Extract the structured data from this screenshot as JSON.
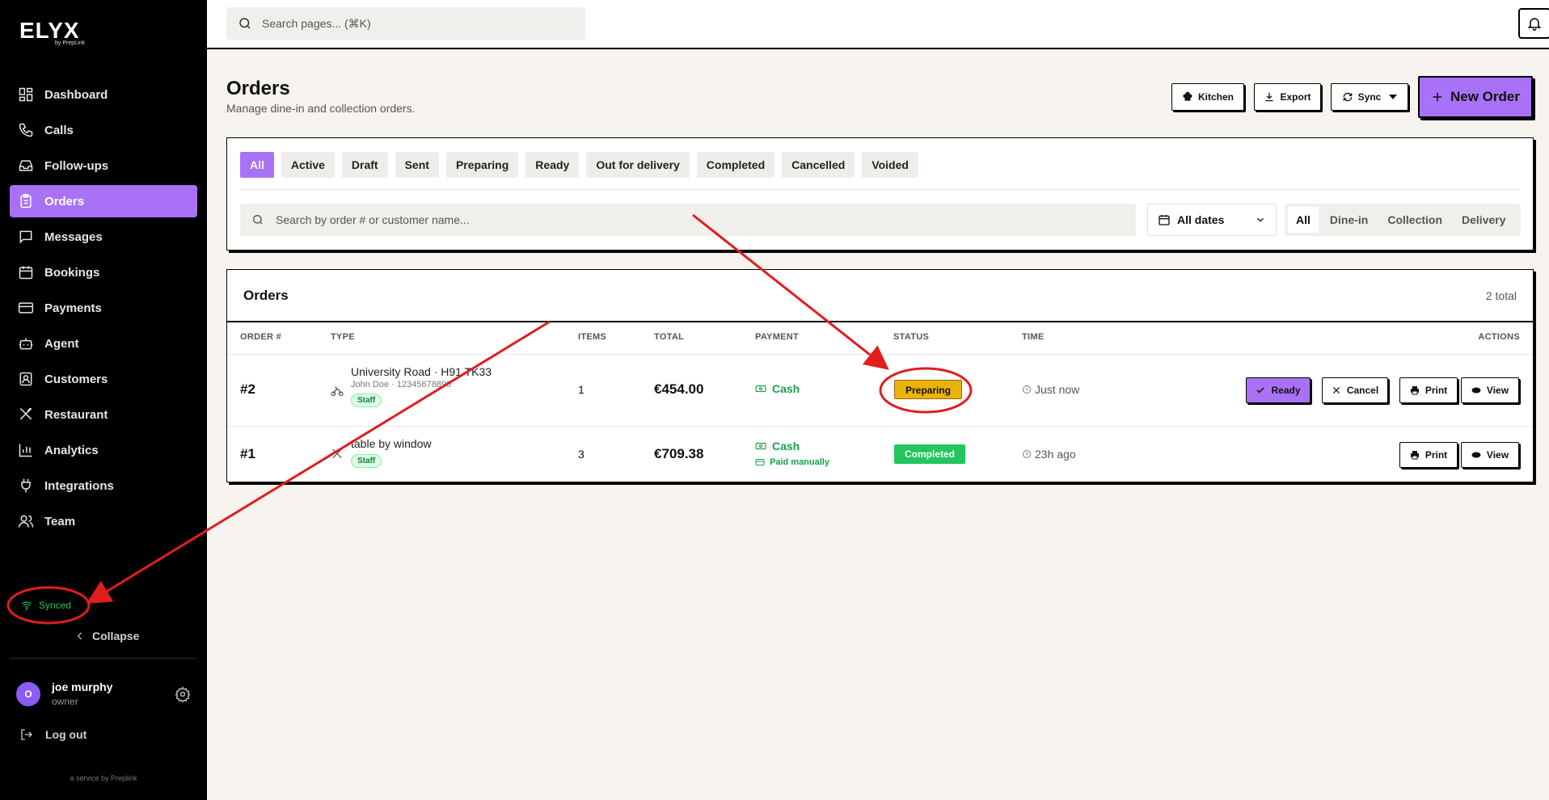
{
  "brand": {
    "name": "ELYX",
    "byline": "by PrepLink"
  },
  "sidebar": {
    "items": [
      {
        "label": "Dashboard",
        "icon": "dashboard-icon"
      },
      {
        "label": "Calls",
        "icon": "phone-icon"
      },
      {
        "label": "Follow-ups",
        "icon": "inbox-icon"
      },
      {
        "label": "Orders",
        "icon": "clipboard-icon",
        "active": true
      },
      {
        "label": "Messages",
        "icon": "message-icon"
      },
      {
        "label": "Bookings",
        "icon": "calendar-icon"
      },
      {
        "label": "Payments",
        "icon": "credit-card-icon"
      },
      {
        "label": "Agent",
        "icon": "bot-icon"
      },
      {
        "label": "Customers",
        "icon": "contact-icon"
      },
      {
        "label": "Restaurant",
        "icon": "utensils-icon"
      },
      {
        "label": "Analytics",
        "icon": "bar-chart-icon"
      },
      {
        "label": "Integrations",
        "icon": "plug-icon"
      },
      {
        "label": "Team",
        "icon": "users-icon"
      }
    ],
    "sync_status": "Synced",
    "collapse_label": "Collapse",
    "user": {
      "initial": "O",
      "name": "joe murphy",
      "role": "owner"
    },
    "logout_label": "Log out",
    "footer": "a service by Preplink"
  },
  "topbar": {
    "search_placeholder": "Search pages... (⌘K)"
  },
  "header": {
    "title": "Orders",
    "subtitle": "Manage dine-in and collection orders.",
    "kitchen_label": "Kitchen",
    "export_label": "Export",
    "sync_label": "Sync",
    "new_order_label": "New Order"
  },
  "filters": {
    "status_tabs": [
      "All",
      "Active",
      "Draft",
      "Sent",
      "Preparing",
      "Ready",
      "Out for delivery",
      "Completed",
      "Cancelled",
      "Voided"
    ],
    "active_status": "All",
    "search_placeholder": "Search by order # or customer name...",
    "date_range": "All dates",
    "type_tabs": [
      "All",
      "Dine-in",
      "Collection",
      "Delivery"
    ],
    "active_type": "All"
  },
  "orders_table": {
    "title": "Orders",
    "total_label": "2 total",
    "columns": [
      "ORDER #",
      "TYPE",
      "ITEMS",
      "TOTAL",
      "PAYMENT",
      "STATUS",
      "TIME",
      "ACTIONS"
    ],
    "rows": [
      {
        "order_num": "#2",
        "type_icon": "bike-icon",
        "type_main": "University Road · H91 TK33",
        "type_sub": "John Doe · 12345678890",
        "badge": "Staff",
        "items": "1",
        "total": "€454.00",
        "payment": "Cash",
        "payment_sub": "",
        "status": "Preparing",
        "time": "Just now",
        "actions": [
          "Ready",
          "Cancel",
          "Print",
          "View"
        ]
      },
      {
        "order_num": "#1",
        "type_icon": "utensils-crossed-icon",
        "type_main": "table by window",
        "type_sub": "",
        "badge": "Staff",
        "items": "3",
        "total": "€709.38",
        "payment": "Cash",
        "payment_sub": "Paid manually",
        "status": "Completed",
        "time": "23h ago",
        "actions": [
          "Print",
          "View"
        ]
      }
    ]
  },
  "colors": {
    "accent": "#a972f6",
    "sidebar_bg": "#000000",
    "page_bg": "#f7f3ee",
    "preparing": "#eab308",
    "completed": "#22c55e",
    "annotation": "#e11d1d"
  }
}
